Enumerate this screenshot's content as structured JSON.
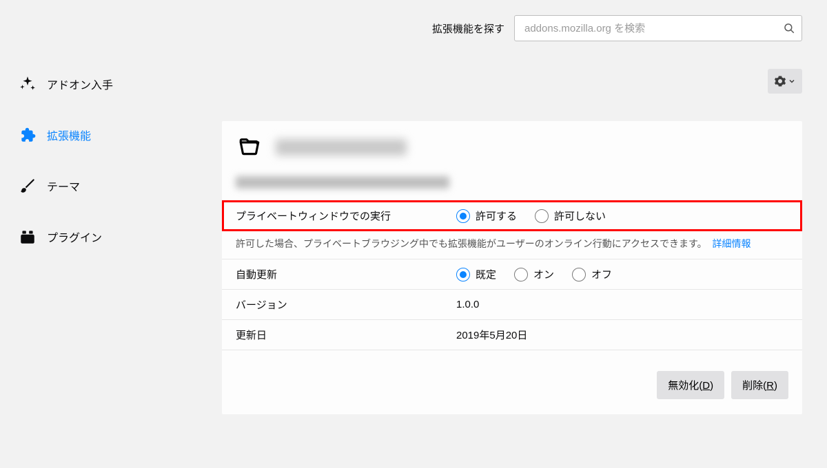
{
  "search": {
    "label": "拡張機能を探す",
    "placeholder": "addons.mozilla.org を検索"
  },
  "sidebar": {
    "items": [
      {
        "id": "get-addons",
        "label": "アドオン入手"
      },
      {
        "id": "extensions",
        "label": "拡張機能"
      },
      {
        "id": "themes",
        "label": "テーマ"
      },
      {
        "id": "plugins",
        "label": "プラグイン"
      }
    ],
    "selected": "extensions"
  },
  "detail": {
    "private_row_label": "プライベートウィンドウでの実行",
    "private_allow": "許可する",
    "private_deny": "許可しない",
    "private_selected": "allow",
    "private_hint_text": "許可した場合、プライベートブラウジング中でも拡張機能がユーザーのオンライン行動にアクセスできます。",
    "private_hint_link": "詳細情報",
    "autoupdate_label": "自動更新",
    "autoupdate_default": "既定",
    "autoupdate_on": "オン",
    "autoupdate_off": "オフ",
    "autoupdate_selected": "default",
    "version_label": "バージョン",
    "version_value": "1.0.0",
    "updated_label": "更新日",
    "updated_value": "2019年5月20日"
  },
  "footer": {
    "disable_label": "無効化",
    "disable_accel": "D",
    "remove_label": "削除",
    "remove_accel": "R"
  }
}
